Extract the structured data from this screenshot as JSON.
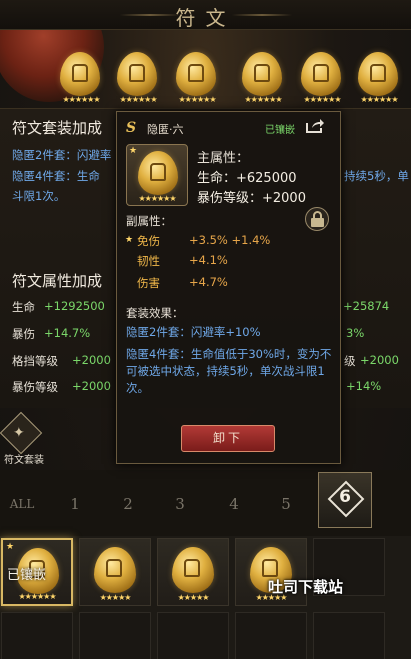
{
  "header": {
    "title": "符文"
  },
  "top_runes": [
    {
      "stars": "★★★★★★"
    },
    {
      "stars": "★★★★★★"
    },
    {
      "stars": "★★★★★★"
    },
    {
      "stars": "★★★★★★"
    },
    {
      "stars": "★★★★★★"
    },
    {
      "stars": "★★★★★★"
    }
  ],
  "left_panel": {
    "set_bonus_title": "符文套装加成",
    "set2": "隐匿2件套：闪避率",
    "set4_a": "隐匿4件套：生命",
    "set4_b": "斗限1次。",
    "set4_right": "持续5秒，单",
    "attr_title": "符文属性加成",
    "rows": [
      {
        "name": "生命",
        "value": "+1292500",
        "right_value": "+25874"
      },
      {
        "name": "暴伤",
        "value": "+14.7%",
        "right_value": "3%"
      },
      {
        "name": "格挡等级",
        "value": "+2000",
        "right_label": "级",
        "right_value": "+2000"
      },
      {
        "name": "暴伤等级",
        "value": "+2000",
        "right_value": "+14%"
      }
    ]
  },
  "popup": {
    "logo": "S",
    "name": "隐匿·六",
    "status": "已镶嵌",
    "main_title": "主属性：",
    "main_stats": [
      "生命：+625000",
      "暴伤等级：+2000"
    ],
    "sub_title": "副属性：",
    "sub_stats": [
      {
        "name": "免伤",
        "value": "+3.5% +1.4%",
        "starred": true
      },
      {
        "name": "韧性",
        "value": "+4.1%"
      },
      {
        "name": "伤害",
        "value": "+4.7%"
      }
    ],
    "set_title": "套装效果：",
    "set_2": "隐匿2件套：闪避率+10%",
    "set_4": "隐匿4件套：生命值低于30%时，变为不可被选中状态，持续5秒，单次战斗限1次。",
    "unequip": "卸下",
    "icon_stars": "★★★★★★"
  },
  "set_button": {
    "label": "符文套装"
  },
  "tabs": [
    "ALL",
    "1",
    "2",
    "3",
    "4",
    "5"
  ],
  "active_tab": "6",
  "inventory": {
    "embedded_label": "已镶嵌",
    "cells": [
      {
        "stars": "★★★★★★"
      },
      {
        "stars": "★★★★★"
      },
      {
        "stars": "★★★★★"
      },
      {
        "stars": "★★★★★"
      }
    ]
  },
  "watermark": "吐司下载站",
  "colors": {
    "gold": "#e8c05a",
    "blue_text": "#6fa8e8",
    "green_text": "#7bd86a",
    "orange_text": "#e7a64a",
    "button_red": "#a2302c"
  }
}
